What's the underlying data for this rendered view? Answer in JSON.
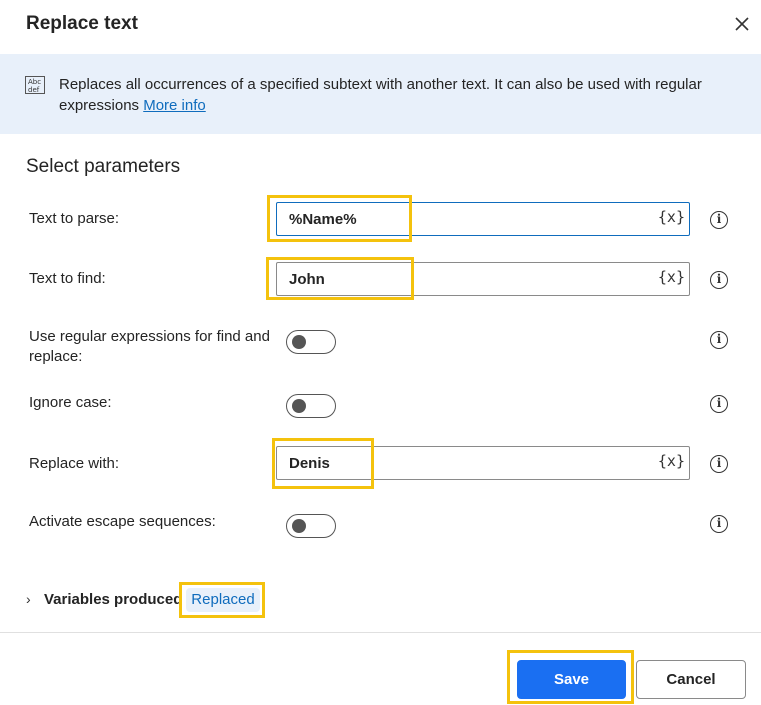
{
  "dialog": {
    "title": "Replace text",
    "close_icon": "close-icon"
  },
  "banner": {
    "icon": "text-abc-icon",
    "icon_text": "Abc def",
    "description": "Replaces all occurrences of a specified subtext with another text. It can also be used with regular expressions",
    "link": "More info"
  },
  "section_title": "Select parameters",
  "params": {
    "text_to_parse": {
      "label": "Text to parse:",
      "value": "%Name%",
      "var_button": "{x}"
    },
    "text_to_find": {
      "label": "Text to find:",
      "value": "John",
      "var_button": "{x}"
    },
    "use_regex": {
      "label": "Use regular expressions for find and replace:",
      "checked": false
    },
    "ignore_case": {
      "label": "Ignore case:",
      "checked": false
    },
    "replace_with": {
      "label": "Replace with:",
      "value": "Denis",
      "var_button": "{x}"
    },
    "escape_sequences": {
      "label": "Activate escape sequences:",
      "checked": false
    }
  },
  "info_glyph": "i",
  "variables": {
    "chevron": "›",
    "label": "Variables produced",
    "items": [
      "Replaced"
    ]
  },
  "buttons": {
    "save": "Save",
    "cancel": "Cancel"
  },
  "colors": {
    "accent": "#0f6cbd",
    "primary_button": "#1a6ff2",
    "banner_bg": "#e8f0fa",
    "highlight": "#f4c20d"
  }
}
